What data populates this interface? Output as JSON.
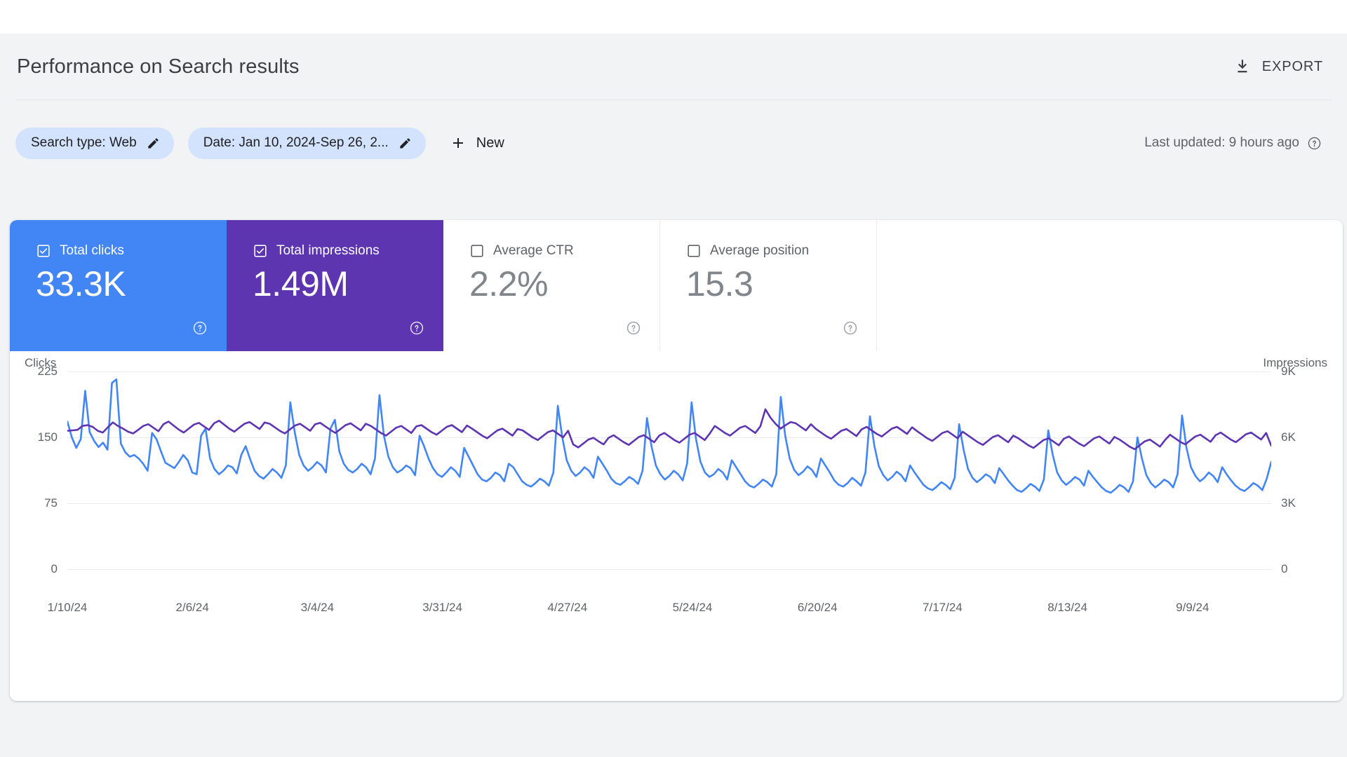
{
  "header": {
    "title": "Performance on Search results",
    "export_label": "EXPORT",
    "export_icon": "download-icon"
  },
  "filters": {
    "chips": [
      {
        "label": "Search type: Web",
        "edit_icon": "pencil-icon"
      },
      {
        "label": "Date: Jan 10, 2024-Sep 26, 2...",
        "edit_icon": "pencil-icon"
      }
    ],
    "new_label": "New",
    "new_icon": "plus-icon",
    "last_updated": "Last updated: 9 hours ago",
    "help_icon": "help-circle-icon"
  },
  "metrics": [
    {
      "label": "Total clicks",
      "value": "33.3K",
      "checked": true,
      "color": "#4285f4",
      "help_icon": "help-circle-icon"
    },
    {
      "label": "Total impressions",
      "value": "1.49M",
      "checked": true,
      "color": "#5e35b1",
      "help_icon": "help-circle-icon"
    },
    {
      "label": "Average CTR",
      "value": "2.2%",
      "checked": false,
      "color": "#ffffff",
      "help_icon": "help-circle-icon"
    },
    {
      "label": "Average position",
      "value": "15.3",
      "checked": false,
      "color": "#ffffff",
      "help_icon": "help-circle-icon"
    }
  ],
  "chart_data": {
    "type": "line",
    "title": "Performance on Search results",
    "xlabel": "",
    "ylabel": "Clicks",
    "y2label": "Impressions",
    "grid": true,
    "legend": "metric-cards",
    "ylim": [
      0,
      225
    ],
    "y2lim": [
      0,
      9000
    ],
    "yticks": [
      "0",
      "75",
      "150",
      "225"
    ],
    "ytick_values": [
      0,
      75,
      150,
      225
    ],
    "y2ticks": [
      "0",
      "3K",
      "6K",
      "9K"
    ],
    "y2tick_values": [
      0,
      3000,
      6000,
      9000
    ],
    "xticks": [
      "1/10/24",
      "2/6/24",
      "3/4/24",
      "3/31/24",
      "4/27/24",
      "5/24/24",
      "6/20/24",
      "7/17/24",
      "8/13/24",
      "9/9/24"
    ],
    "xtick_indices": [
      0,
      27,
      54,
      81,
      108,
      135,
      162,
      189,
      216,
      243
    ],
    "x_start": "1/10/24",
    "x_end": "9/26/24",
    "n_points": 261,
    "series": [
      {
        "name": "Clicks",
        "color": "#4285f4",
        "axis": "left",
        "values": [
          168,
          150,
          138,
          148,
          203,
          156,
          146,
          139,
          144,
          136,
          212,
          216,
          143,
          133,
          128,
          130,
          126,
          120,
          112,
          155,
          148,
          134,
          121,
          118,
          115,
          122,
          130,
          124,
          110,
          108,
          152,
          160,
          126,
          114,
          108,
          112,
          118,
          116,
          109,
          130,
          140,
          125,
          112,
          106,
          103,
          108,
          114,
          110,
          104,
          118,
          190,
          156,
          130,
          118,
          112,
          116,
          122,
          118,
          110,
          160,
          170,
          134,
          120,
          113,
          110,
          114,
          120,
          116,
          108,
          126,
          198,
          152,
          128,
          116,
          110,
          113,
          118,
          115,
          107,
          152,
          140,
          126,
          115,
          108,
          105,
          110,
          116,
          112,
          105,
          138,
          128,
          118,
          108,
          102,
          100,
          104,
          110,
          107,
          100,
          120,
          116,
          108,
          100,
          96,
          94,
          98,
          103,
          100,
          95,
          110,
          186,
          150,
          124,
          112,
          106,
          110,
          116,
          112,
          104,
          128,
          120,
          112,
          103,
          98,
          96,
          100,
          105,
          102,
          97,
          112,
          172,
          140,
          118,
          108,
          102,
          106,
          112,
          108,
          101,
          120,
          190,
          148,
          122,
          110,
          105,
          108,
          114,
          110,
          102,
          124,
          116,
          108,
          100,
          95,
          93,
          97,
          102,
          99,
          94,
          108,
          196,
          152,
          126,
          113,
          107,
          111,
          117,
          113,
          105,
          126,
          118,
          110,
          101,
          96,
          94,
          98,
          104,
          100,
          95,
          110,
          174,
          140,
          117,
          107,
          101,
          105,
          111,
          107,
          100,
          118,
          110,
          103,
          96,
          92,
          90,
          94,
          99,
          96,
          91,
          104,
          165,
          136,
          114,
          104,
          99,
          103,
          108,
          105,
          98,
          115,
          108,
          101,
          95,
          90,
          88,
          92,
          97,
          94,
          89,
          102,
          158,
          130,
          110,
          101,
          96,
          100,
          105,
          102,
          95,
          112,
          105,
          99,
          93,
          89,
          87,
          91,
          96,
          93,
          88,
          100,
          150,
          126,
          107,
          98,
          93,
          97,
          102,
          99,
          93,
          108,
          175,
          138,
          116,
          106,
          100,
          104,
          110,
          106,
          99,
          116,
          108,
          101,
          95,
          91,
          89,
          93,
          98,
          95,
          90,
          103,
          122
        ]
      },
      {
        "name": "Impressions",
        "color": "#5e35b1",
        "axis": "right",
        "values": [
          6300,
          6320,
          6340,
          6520,
          6560,
          6480,
          6300,
          6220,
          6460,
          6680,
          6520,
          6400,
          6260,
          6180,
          6340,
          6520,
          6600,
          6440,
          6280,
          6600,
          6720,
          6540,
          6360,
          6220,
          6400,
          6580,
          6660,
          6500,
          6340,
          6640,
          6760,
          6580,
          6400,
          6260,
          6440,
          6620,
          6700,
          6540,
          6380,
          6680,
          6620,
          6460,
          6300,
          6180,
          6360,
          6540,
          6620,
          6460,
          6300,
          6600,
          6660,
          6500,
          6340,
          6200,
          6380,
          6560,
          6640,
          6480,
          6320,
          6620,
          6520,
          6360,
          6200,
          6080,
          6260,
          6440,
          6520,
          6360,
          6200,
          6500,
          6560,
          6400,
          6240,
          6120,
          6300,
          6480,
          6560,
          6400,
          6240,
          6540,
          6400,
          6240,
          6080,
          5960,
          6140,
          6320,
          6400,
          6240,
          6080,
          6380,
          6320,
          6160,
          6000,
          5880,
          6060,
          6240,
          6320,
          6160,
          6000,
          6300,
          5680,
          5540,
          5720,
          5900,
          5980,
          5820,
          5680,
          5980,
          6100,
          5940,
          5780,
          5660,
          5840,
          6020,
          6100,
          5940,
          5780,
          6080,
          6200,
          6040,
          5880,
          5760,
          5940,
          6120,
          6200,
          6040,
          5880,
          6180,
          6520,
          6360,
          6200,
          6080,
          6260,
          6440,
          6520,
          6360,
          6200,
          6500,
          7280,
          6900,
          6620,
          6400,
          6560,
          6700,
          6640,
          6480,
          6320,
          6600,
          6380,
          6220,
          6060,
          5940,
          6120,
          6300,
          6380,
          6220,
          6060,
          6360,
          6480,
          6320,
          6160,
          6040,
          6220,
          6400,
          6480,
          6320,
          6160,
          6460,
          6280,
          6120,
          5960,
          5840,
          6020,
          6200,
          6280,
          6120,
          5960,
          6260,
          6100,
          5940,
          5780,
          5660,
          5840,
          6020,
          6100,
          5940,
          5780,
          6080,
          5960,
          5800,
          5640,
          5520,
          5700,
          5880,
          5960,
          5800,
          5640,
          5940,
          6040,
          5880,
          5720,
          5600,
          5780,
          5960,
          6040,
          5880,
          5720,
          6020,
          5900,
          5740,
          5580,
          5460,
          5640,
          5820,
          5900,
          5740,
          5580,
          5880,
          6120,
          5960,
          5800,
          5680,
          5860,
          6040,
          6120,
          5960,
          5800,
          6100,
          6220,
          6060,
          5900,
          5780,
          5960,
          6140,
          6220,
          6060,
          5900,
          6200,
          5620
        ]
      }
    ]
  }
}
